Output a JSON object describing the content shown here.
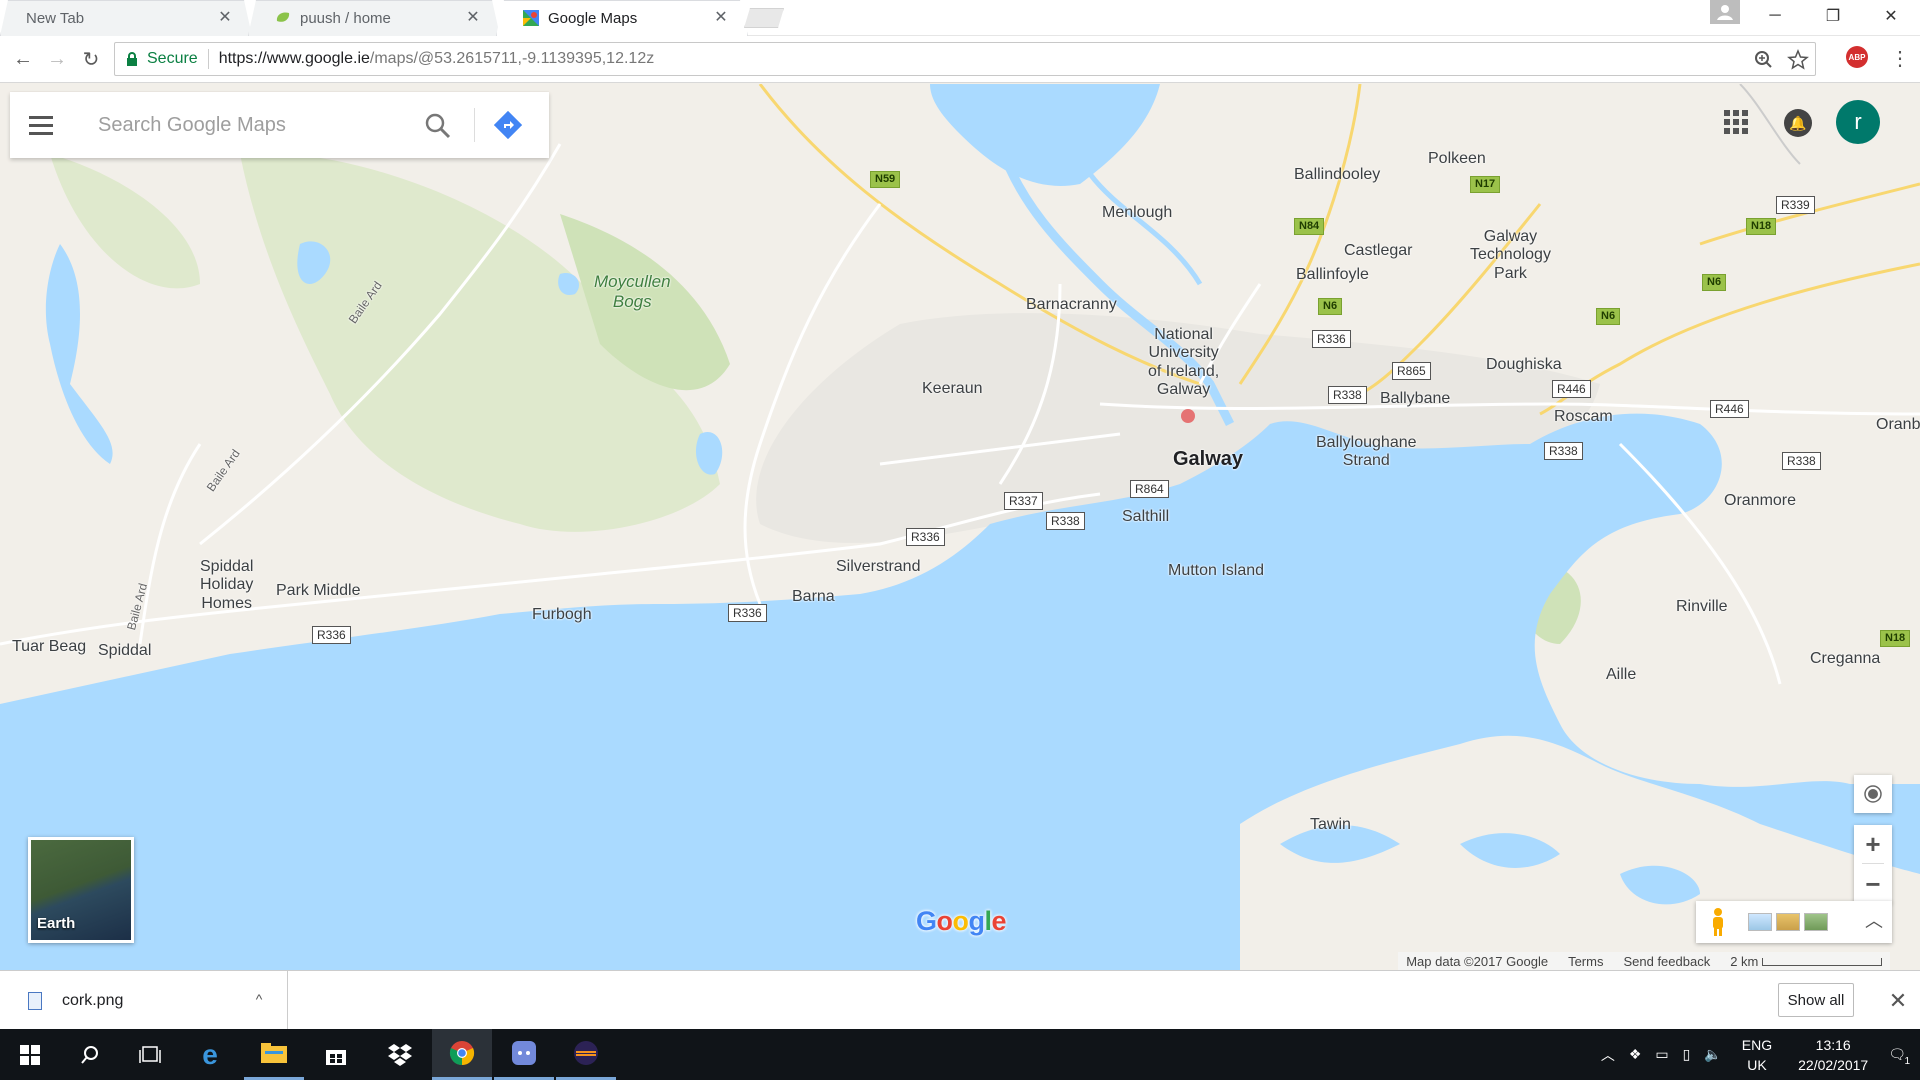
{
  "browser": {
    "tabs": [
      {
        "title": "New Tab",
        "active": false
      },
      {
        "title": "puush / home",
        "active": false
      },
      {
        "title": "Google Maps",
        "active": true
      }
    ],
    "secure_label": "Secure",
    "url_host": "https://www.google.ie",
    "url_rest": "/maps/@53.2615711,-9.1139395,12.12z",
    "abp_label": "ABP"
  },
  "maps": {
    "search_placeholder": "Search Google Maps",
    "account_initial": "r",
    "earth_label": "Earth",
    "google_logo": "Google",
    "attribution": {
      "map_data": "Map data ©2017 Google",
      "terms": "Terms",
      "send_feedback": "Send feedback",
      "scale": "2 km"
    },
    "places": {
      "galway": "Galway",
      "moycullen_bogs": "Moycullen\nBogs",
      "nuig": "National\nUniversity\nof Ireland,\nGalway",
      "menlough": "Menlough",
      "ballindooley": "Ballindooley",
      "polkeen": "Polkeen",
      "castlegar": "Castlegar",
      "galway_tech_park": "Galway\nTechnology\nPark",
      "ballinfoyle": "Ballinfoyle",
      "barnacranny": "Barnacranny",
      "keeraun": "Keeraun",
      "doughiska": "Doughiska",
      "ballybane": "Ballybane",
      "roscam": "Roscam",
      "oranb": "Oranb",
      "ballyloughane": "Ballyloughane\nStrand",
      "salthill": "Salthill",
      "mutton_island": "Mutton Island",
      "oranmore": "Oranmore",
      "silverstrand": "Silverstrand",
      "barna": "Barna",
      "furbogh": "Furbogh",
      "spiddal_holiday": "Spiddal\nHoliday\nHomes",
      "park_middle": "Park Middle",
      "tuar_beag": "Tuar Beag",
      "spiddal": "Spiddal",
      "rinville": "Rinville",
      "aille": "Aille",
      "creganna": "Creganna",
      "tawin": "Tawin",
      "baile_ard_1": "Baile Ard",
      "baile_ard_2": "Baile Ard",
      "baile_ard_3": "Baile Ard"
    },
    "roads": {
      "n59": "N59",
      "n84": "N84",
      "n17": "N17",
      "n18a": "N18",
      "n18b": "N18",
      "n6a": "N6",
      "n6b": "N6",
      "n6c": "N6",
      "r339": "R339",
      "r336a": "R336",
      "r336b": "R336",
      "r336c": "R336",
      "r336d": "R336",
      "r865": "R865",
      "r338a": "R338",
      "r338b": "R338",
      "r338c": "R338",
      "r338d": "R338",
      "r446a": "R446",
      "r446b": "R446",
      "r864": "R864",
      "r337": "R337"
    }
  },
  "downloads": {
    "file_name": "cork.png",
    "show_all": "Show all"
  },
  "taskbar": {
    "lang_line1": "ENG",
    "lang_line2": "UK",
    "time": "13:16",
    "date": "22/02/2017",
    "notif_count": "1"
  },
  "colors": {
    "water": "#aadaff",
    "land": "#f2efe9",
    "park": "#cfe2b8",
    "urban": "#e8e6e1",
    "accent": "#1a73e8",
    "avatar": "#00796b"
  }
}
